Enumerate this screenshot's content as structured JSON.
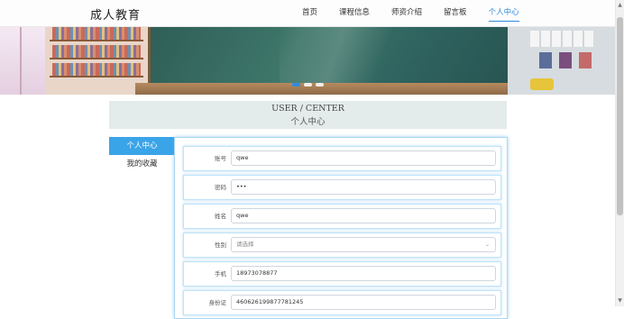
{
  "header": {
    "logo": "成人教育",
    "nav": [
      "首页",
      "课程信息",
      "师资介绍",
      "留言板",
      "个人中心"
    ],
    "active_index": 4
  },
  "banner": {
    "slide_count": 3,
    "active_slide": 1
  },
  "center": {
    "title_en": "USER / CENTER",
    "title_cn": "个人中心"
  },
  "sidebar": {
    "items": [
      "个人中心",
      "我的收藏"
    ],
    "active_index": 0
  },
  "form": {
    "account": {
      "label": "账号",
      "value": "qwe"
    },
    "password": {
      "label": "密码",
      "value": "•••"
    },
    "name": {
      "label": "姓名",
      "value": "qwe"
    },
    "gender": {
      "label": "性别",
      "placeholder": "请选择"
    },
    "phone": {
      "label": "手机",
      "value": "18973078877"
    },
    "id_card": {
      "label": "身份证",
      "value": "460626199877781245"
    }
  },
  "colors": {
    "accent": "#2f8ae0",
    "sidebar_active": "#3aa4e8",
    "title_band": "#e3eceb"
  }
}
